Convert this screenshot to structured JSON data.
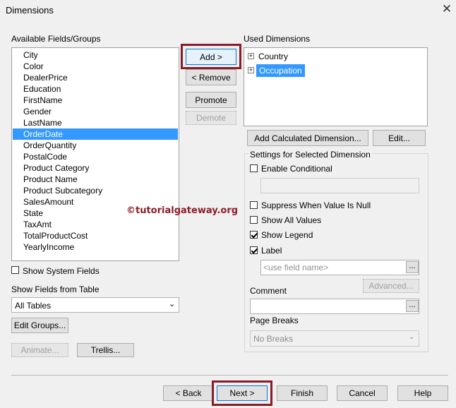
{
  "window": {
    "title": "Dimensions"
  },
  "available": {
    "label": "Available Fields/Groups",
    "items": [
      "City",
      "Color",
      "DealerPrice",
      "Education",
      "FirstName",
      "Gender",
      "LastName",
      "OrderDate",
      "OrderQuantity",
      "PostalCode",
      "Product Category",
      "Product Name",
      "Product Subcategory",
      "SalesAmount",
      "State",
      "TaxAmt",
      "TotalProductCost",
      "YearlyIncome"
    ],
    "selected": "OrderDate"
  },
  "watermark": "©tutorialgateway.org",
  "middle_buttons": {
    "add": "Add >",
    "remove": "< Remove",
    "promote": "Promote",
    "demote": "Demote"
  },
  "used": {
    "label": "Used Dimensions",
    "items": [
      "Country",
      "Occupation"
    ],
    "selected": "Occupation"
  },
  "add_calc_button": "Add Calculated Dimension...",
  "edit_button": "Edit...",
  "settings": {
    "label": "Settings for Selected Dimension",
    "enable_conditional": "Enable Conditional",
    "suppress_null": "Suppress When Value Is Null",
    "show_all_values": "Show All Values",
    "show_legend": "Show Legend",
    "label_check": "Label",
    "label_placeholder": "<use field name>",
    "advanced": "Advanced...",
    "comment": "Comment",
    "page_breaks": "Page Breaks",
    "page_breaks_value": "No Breaks"
  },
  "show_system_fields": "Show System Fields",
  "show_fields_from_table": {
    "label": "Show Fields from Table",
    "value": "All Tables"
  },
  "edit_groups": "Edit Groups...",
  "animate": "Animate...",
  "trellis": "Trellis...",
  "footer": {
    "back": "< Back",
    "next": "Next >",
    "finish": "Finish",
    "cancel": "Cancel",
    "help": "Help"
  },
  "checks": {
    "enable_conditional": false,
    "suppress_null": false,
    "show_all_values": false,
    "show_legend": true,
    "label": true,
    "show_system_fields": false
  },
  "colors": {
    "selection": "#3399ff",
    "highlight_box": "#8b1c26",
    "watermark": "#8b1c26"
  }
}
